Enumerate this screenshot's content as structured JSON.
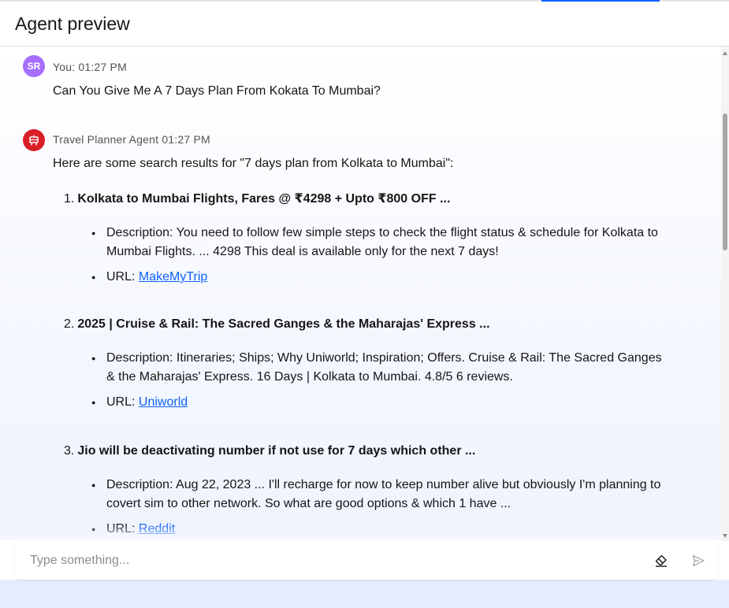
{
  "header": {
    "title": "Agent preview"
  },
  "messages": {
    "user": {
      "avatar_initials": "SR",
      "meta": "You: 01:27 PM",
      "text": "Can You Give Me A 7 Days Plan From Kokata To Mumbai?"
    },
    "agent": {
      "meta": "Travel Planner Agent 01:27 PM",
      "intro": "Here are some search results for \"7 days plan from Kolkata to Mumbai\":",
      "results": [
        {
          "number": "1.",
          "title": "Kolkata to Mumbai Flights, Fares @ ₹4298 + Upto ₹800 OFF ...",
          "description": "Description: You need to follow few simple steps to check the flight status & schedule for Kolkata to Mumbai Flights. ... 4298 This deal is available only for the next 7 days!",
          "url_label": "URL: ",
          "url_text": "MakeMyTrip"
        },
        {
          "number": "2.",
          "title": "2025 | Cruise & Rail: The Sacred Ganges & the Maharajas' Express ...",
          "description": "Description: Itineraries; Ships; Why Uniworld; Inspiration; Offers. Cruise & Rail: The Sacred Ganges & the Maharajas' Express. 16 Days | Kolkata to Mumbai. 4.8/5 6 reviews.",
          "url_label": "URL: ",
          "url_text": "Uniworld"
        },
        {
          "number": "3.",
          "title": "Jio will be deactivating number if not use for 7 days which other ...",
          "description": "Description: Aug 22, 2023 ... I'll recharge for now to keep number alive but obviously I'm planning to covert sim to other network. So what are good options & which 1 have ...",
          "url_label": "URL: ",
          "url_text": "Reddit"
        }
      ]
    }
  },
  "input": {
    "placeholder": "Type something..."
  },
  "icons": {
    "agent_avatar": "robot-icon",
    "clear": "eraser-icon",
    "send": "send-icon"
  },
  "colors": {
    "user_avatar": "#a56eff",
    "agent_avatar": "#da1e28",
    "link": "#0f62fe"
  }
}
